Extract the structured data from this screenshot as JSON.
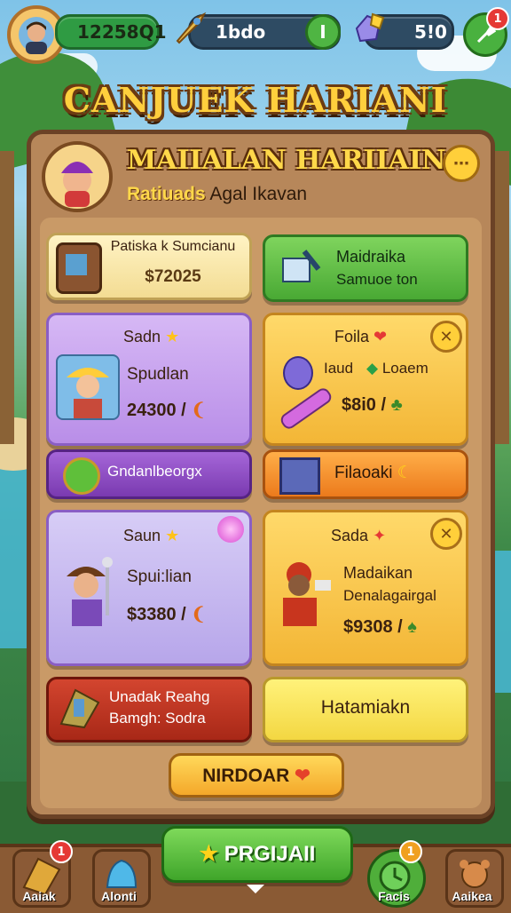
{
  "topbar": {
    "coins": "12258Q1",
    "energy": "1bdo",
    "gems": "5!0"
  },
  "banner": {
    "title": "CANJUEK HARIANI"
  },
  "panel": {
    "title": "MAIIALAN HARIIAIN",
    "subtitle_highlight": "Ratiuads",
    "subtitle_rest": "Agal Ikavan"
  },
  "cards": {
    "c1": {
      "title": "Patiska k Sumcianu",
      "price": "$72025"
    },
    "c2": {
      "title": "Maidraika",
      "subtitle": "Samuoe ton"
    },
    "c3": {
      "title": "Sadn",
      "name": "Spudlan",
      "price": "24300 /"
    },
    "c4": {
      "title": "Foila",
      "line": "Iaud",
      "line2": "Loaem",
      "price": "$8i0 /"
    },
    "c5": {
      "label": "Gndanlbeorgx"
    },
    "c6": {
      "label": "Filaoaki"
    },
    "c7": {
      "title": "Saun",
      "name": "Spui:lian",
      "price": "$3380 /"
    },
    "c8": {
      "title": "Sada",
      "line1": "Madaikan",
      "line2": "Denalagairgal",
      "price": "$9308 /"
    },
    "c9": {
      "line1": "Unadak Reahg",
      "line2": "Bamgh: Sodra"
    },
    "c10": {
      "label": "Hatamiakn"
    }
  },
  "cta_small": "NIRDOAR",
  "cta_main": "PRGIJAII",
  "notifications": {
    "top_right": "1",
    "nav_left": "1",
    "nav_right": "1"
  },
  "nav": {
    "left1": "Aaiak",
    "left2": "Alonti",
    "right1": "Facis",
    "right2": "Aaikea"
  }
}
